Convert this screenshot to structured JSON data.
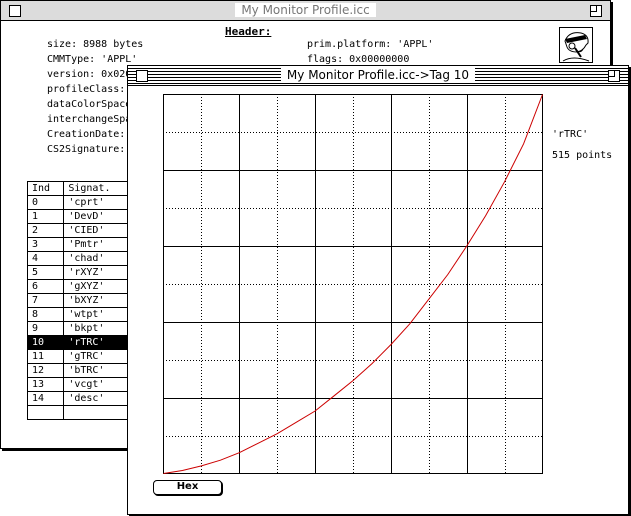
{
  "back_window": {
    "title": "My Monitor Profile.icc",
    "header_label": "Header:",
    "fields": {
      "size": "size:    8988 bytes",
      "cmm": "CMMType: 'APPL'",
      "version": "version: 0x020",
      "profileClass": "profileClass:",
      "dataColorSpace": "dataColorSpace",
      "interchangeSpace": "interchangeSpa",
      "creationDate": "CreationDate:",
      "cs2Signature": "CS2Signature:",
      "platform": "prim.platform: 'APPL'",
      "flags": "flags: 0x00000000"
    },
    "table": {
      "headers": [
        "Ind",
        "Signat."
      ],
      "rows": [
        [
          "0",
          "'cprt'"
        ],
        [
          "1",
          "'DevD'"
        ],
        [
          "2",
          "'CIED'"
        ],
        [
          "3",
          "'Pmtr'"
        ],
        [
          "4",
          "'chad'"
        ],
        [
          "5",
          "'rXYZ'"
        ],
        [
          "6",
          "'gXYZ'"
        ],
        [
          "7",
          "'bXYZ'"
        ],
        [
          "8",
          "'wtpt'"
        ],
        [
          "9",
          "'bkpt'"
        ],
        [
          "10",
          "'rTRC'"
        ],
        [
          "11",
          "'gTRC'"
        ],
        [
          "12",
          "'bTRC'"
        ],
        [
          "13",
          "'vcgt'"
        ],
        [
          "14",
          "'desc'"
        ]
      ],
      "selected_index": 10
    },
    "icon": "inspector-man-icon"
  },
  "front_window": {
    "title": "My Monitor Profile.icc->Tag 10",
    "tag_label": "'rTRC'",
    "points_label": "515 points",
    "hex_button": "Hex"
  },
  "chart_data": {
    "type": "line",
    "title": "",
    "xlabel": "",
    "ylabel": "",
    "xlim": [
      0,
      1
    ],
    "ylim": [
      0,
      1
    ],
    "grid": true,
    "grid_divisions": 10,
    "series": [
      {
        "color": "#cc0000",
        "x": [
          0,
          0.05,
          0.1,
          0.15,
          0.2,
          0.25,
          0.3,
          0.35,
          0.4,
          0.45,
          0.5,
          0.55,
          0.6,
          0.65,
          0.7,
          0.75,
          0.8,
          0.85,
          0.9,
          0.95,
          1.0
        ],
        "y": [
          0,
          0.008,
          0.02,
          0.035,
          0.055,
          0.08,
          0.105,
          0.135,
          0.165,
          0.205,
          0.245,
          0.29,
          0.34,
          0.395,
          0.46,
          0.525,
          0.6,
          0.68,
          0.77,
          0.87,
          1.0
        ]
      }
    ]
  }
}
